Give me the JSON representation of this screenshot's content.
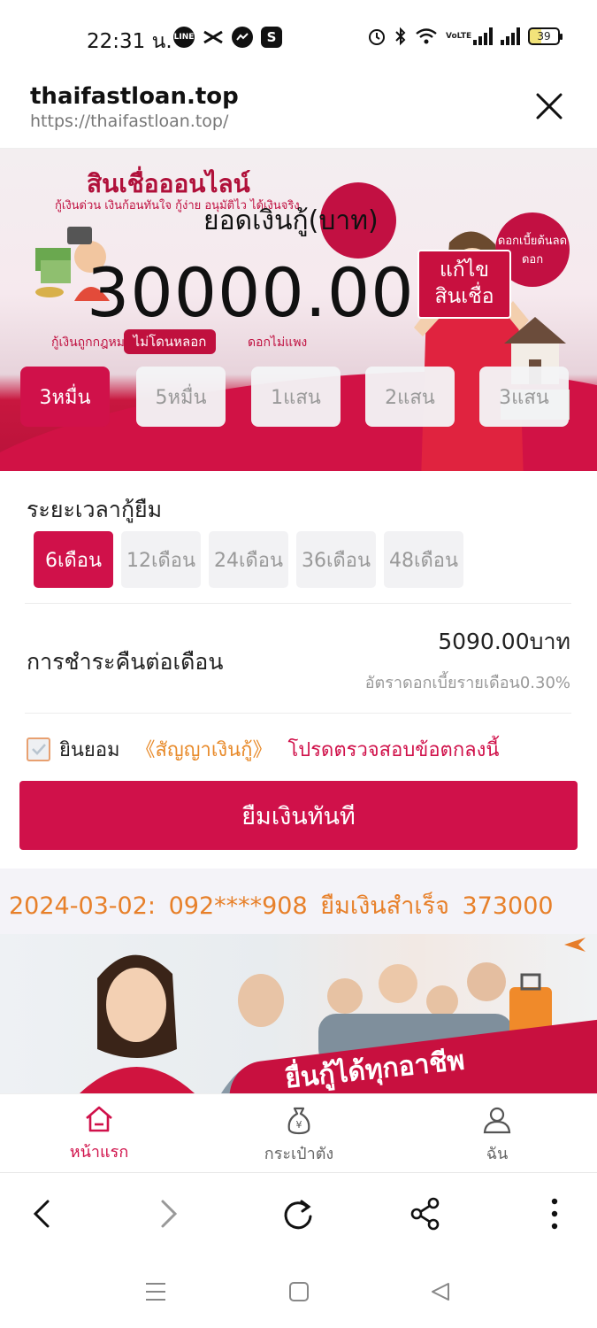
{
  "status_bar": {
    "time": "22:31 น.",
    "apps": [
      "line-icon",
      "capcut-icon",
      "messenger-icon",
      "s-app-icon"
    ],
    "app_badges": {
      "line": "LINE",
      "s": "S"
    },
    "right_icons": [
      "alarm-icon",
      "bluetooth-icon",
      "wifi-icon",
      "volte-icon",
      "signal-icon",
      "signal-icon"
    ],
    "volte_label": "VoLTE",
    "battery": "39"
  },
  "browser": {
    "title": "thaifastloan.top",
    "url": "https://thaifastloan.top/"
  },
  "banner": {
    "headline": "สินเชื่อออนไลน์",
    "sub": "กู้เงินด่วน เงินก้อนทันใจ กู้ง่าย อนุมัติไว ได้เงินจริง",
    "tag": "ไม่โดนหลอก",
    "line2": "กู้เงินถูกกฎหมาย",
    "line2b": "ดอกไม่แพง",
    "bubble": "ดอกเบี้ยต้นลดดอก"
  },
  "loan": {
    "label": "ยอดเงินกู้(บาท)",
    "amount": "30000.00",
    "edit_button": "แก้ไข\nสินเชื่อ"
  },
  "amount_options": [
    {
      "label": "3หมื่น",
      "active": true
    },
    {
      "label": "5หมื่น",
      "active": false
    },
    {
      "label": "1แสน",
      "active": false
    },
    {
      "label": "2แสน",
      "active": false
    },
    {
      "label": "3แสน",
      "active": false
    }
  ],
  "term": {
    "title": "ระยะเวลากู้ยืม",
    "options": [
      {
        "label": "6เดือน",
        "active": true
      },
      {
        "label": "12เดือน",
        "active": false
      },
      {
        "label": "24เดือน",
        "active": false
      },
      {
        "label": "36เดือน",
        "active": false
      },
      {
        "label": "48เดือน",
        "active": false
      }
    ]
  },
  "repayment": {
    "label": "การชำระคืนต่อเดือน",
    "amount": "5090.00บาท",
    "rate": "อัตราดอกเบี้ยรายเดือน0.30%"
  },
  "agreement": {
    "checked": true,
    "agree": "ยินยอม",
    "contract": "《สัญญาเงินกู้》",
    "notice": "โปรดตรวจสอบข้อตกลงนี้"
  },
  "borrow_button": "ยืมเงินทันที",
  "ticker": "2024-03-02:  092****908  ยืมเงินสำเร็จ  373000",
  "promo": {
    "text": "ยื่นกู้ได้ทุกอาชีพ"
  },
  "nav": [
    {
      "label": "หน้าแรก",
      "icon": "home-icon",
      "active": true
    },
    {
      "label": "กระเป๋าตัง",
      "icon": "money-bag-icon",
      "active": false
    },
    {
      "label": "ฉัน",
      "icon": "user-icon",
      "active": false
    }
  ],
  "browser_toolbar": [
    "back-icon",
    "forward-icon",
    "reload-icon",
    "share-icon",
    "more-icon"
  ],
  "system_nav": [
    "recent-apps-icon",
    "home-icon",
    "back-icon"
  ],
  "colors": {
    "accent": "#d0114a",
    "ticker": "#e7802a",
    "link": "#e88a2a"
  }
}
